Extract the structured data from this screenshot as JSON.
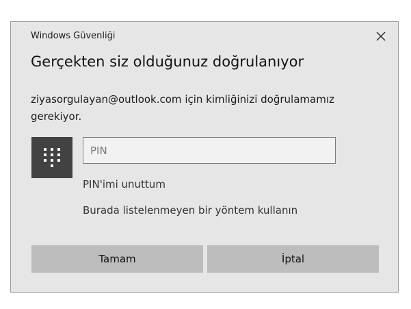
{
  "window": {
    "title": "Windows Güvenliği",
    "close_icon": "close-icon"
  },
  "dialog": {
    "heading": "Gerçekten siz olduğunuz doğrulanıyor",
    "message": "ziyasorgulayan@outlook.com için kimliğinizi doğrulamamız gerekiyor.",
    "pin_icon": "keypad-icon",
    "pin_placeholder": "PIN",
    "pin_value": "",
    "forgot_pin_link": "PIN'imi unuttum",
    "other_method_link": "Burada listelenmeyen bir yöntem kullanın"
  },
  "buttons": {
    "ok_label": "Tamam",
    "cancel_label": "İptal"
  },
  "colors": {
    "dialog_background": "#e6e6e6",
    "pin_tile": "#424242",
    "button_background": "#bdbdbd",
    "input_background": "#f2f2f2"
  }
}
